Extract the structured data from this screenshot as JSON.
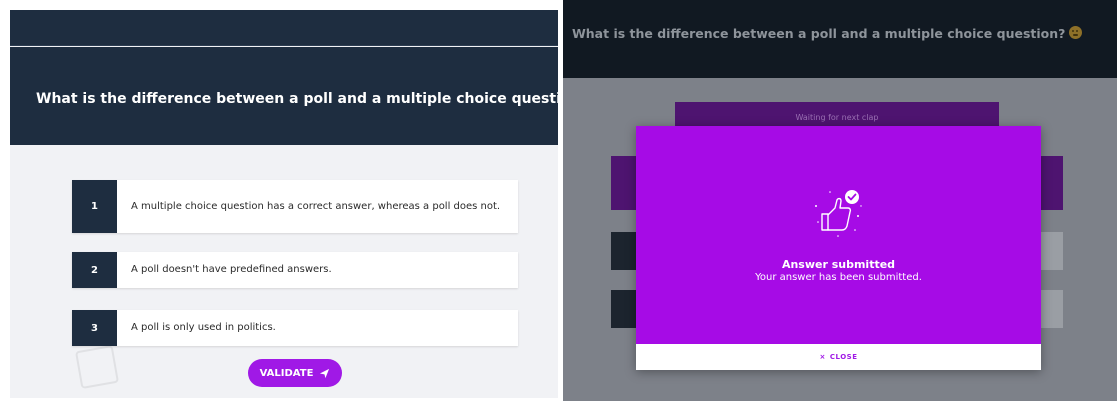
{
  "left": {
    "question": "What is the difference between a poll and a multiple choice question?",
    "answers": [
      {
        "number": "1",
        "text": "A multiple choice question has a correct answer, whereas a poll does not."
      },
      {
        "number": "2",
        "text": "A poll doesn't have predefined answers."
      },
      {
        "number": "3",
        "text": "A poll is only used in politics."
      }
    ],
    "validate_label": "VALIDATE"
  },
  "right": {
    "question": "What is the difference between a poll and a multiple choice question?",
    "waiting_text": "Waiting for next clap",
    "modal": {
      "title": "Answer submitted",
      "message": "Your answer has been submitted.",
      "close_label": "CLOSE",
      "close_symbol": "×"
    }
  },
  "colors": {
    "header_navy": "#1e2d40",
    "accent_purple": "#a60be6",
    "button_purple": "#a019e6"
  },
  "icons": [
    "thinking-face-emoji-icon",
    "send-icon",
    "thumbs-up-check-icon",
    "close-icon"
  ]
}
